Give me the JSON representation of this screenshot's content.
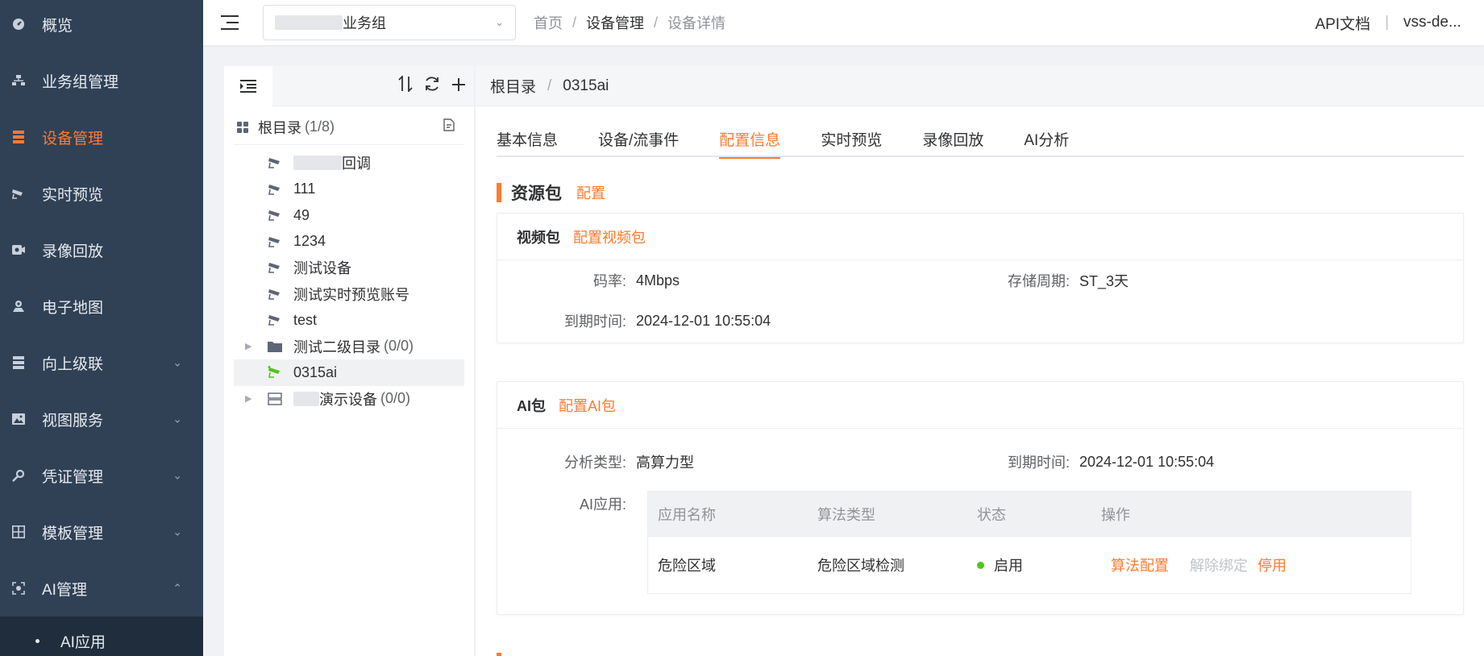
{
  "colors": {
    "accent": "#ff7a2f",
    "sidebar_bg": "#304156",
    "status_on": "#52c41a"
  },
  "sidebar": {
    "items": [
      {
        "label": "概览",
        "icon": "dashboard-icon"
      },
      {
        "label": "业务组管理",
        "icon": "org-chart-icon"
      },
      {
        "label": "设备管理",
        "icon": "list-icon",
        "active": true
      },
      {
        "label": "实时预览",
        "icon": "camera-icon"
      },
      {
        "label": "录像回放",
        "icon": "video-record-icon"
      },
      {
        "label": "电子地图",
        "icon": "map-user-icon"
      },
      {
        "label": "向上级联",
        "icon": "server-icon",
        "arrow": "down"
      },
      {
        "label": "视图服务",
        "icon": "image-icon",
        "arrow": "down"
      },
      {
        "label": "凭证管理",
        "icon": "key-icon",
        "arrow": "down"
      },
      {
        "label": "模板管理",
        "icon": "template-grid-icon",
        "arrow": "down"
      },
      {
        "label": "AI管理",
        "icon": "ai-scan-icon",
        "arrow": "up"
      }
    ],
    "sub_items": [
      {
        "label": "AI应用"
      }
    ]
  },
  "topbar": {
    "group_select": {
      "value_suffix": "业务组"
    },
    "breadcrumb": [
      "首页",
      "设备管理",
      "设备详情"
    ],
    "api_doc": "API文档",
    "user": "vss-de..."
  },
  "tree": {
    "root_label": "根目录",
    "root_count": "(1/8)",
    "nodes": [
      {
        "label_suffix": "回调",
        "type": "camera",
        "masked": true
      },
      {
        "label": "111",
        "type": "camera"
      },
      {
        "label": "49",
        "type": "camera"
      },
      {
        "label": "1234",
        "type": "camera"
      },
      {
        "label": "测试设备",
        "type": "camera"
      },
      {
        "label": "测试实时预览账号",
        "type": "camera"
      },
      {
        "label": "test",
        "type": "camera"
      },
      {
        "label": "测试二级目录",
        "count": "(0/0)",
        "type": "folder"
      },
      {
        "label": "0315ai",
        "type": "camera-online",
        "selected": true
      },
      {
        "label_suffix": "演示设备",
        "count": "(0/0)",
        "type": "server",
        "masked": true
      }
    ]
  },
  "main": {
    "crumb": [
      "根目录",
      "0315ai"
    ],
    "tabs": [
      "基本信息",
      "设备/流事件",
      "配置信息",
      "实时预览",
      "录像回放",
      "AI分析"
    ],
    "active_tab": "配置信息",
    "section": {
      "title": "资源包",
      "link": "配置"
    },
    "video_pkg": {
      "title": "视频包",
      "link": "配置视频包",
      "bitrate_label": "码率:",
      "bitrate_value": "4Mbps",
      "storage_label": "存储周期:",
      "storage_value": "ST_3天",
      "expire_label": "到期时间:",
      "expire_value": "2024-12-01 10:55:04"
    },
    "ai_pkg": {
      "title": "AI包",
      "link": "配置AI包",
      "type_label": "分析类型:",
      "type_value": "高算力型",
      "expire_label": "到期时间:",
      "expire_value": "2024-12-01 10:55:04",
      "apps_label": "AI应用:",
      "table": {
        "headers": [
          "应用名称",
          "算法类型",
          "状态",
          "操作"
        ],
        "rows": [
          {
            "name": "危险区域",
            "algo": "危险区域检测",
            "status": "启用",
            "ops": [
              "算法配置",
              "解除绑定",
              "停用"
            ]
          }
        ]
      }
    }
  }
}
